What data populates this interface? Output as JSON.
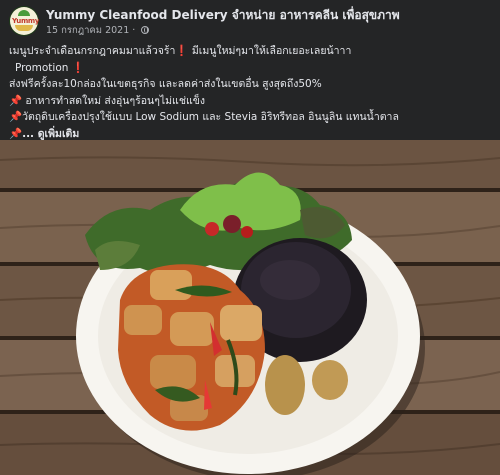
{
  "post": {
    "page_name": "Yummy Cleanfood Delivery จำหน่าย อาหารคลีน เพื่อสุขภาพ",
    "date": "15 กรกฎาคม 2021",
    "logo_text": "Yummy",
    "lines": {
      "l1": "เมนูประจำเดือนกรกฎาคมมาแล้วจร้า",
      "l1b": "มีเมนูใหม่ๆมาให้เลือกเยอะเลยน้าาา",
      "l2": "Promotion",
      "l3": "ส่งฟรีครั้งละ10กล่องในเขตธุรกิจ และลดค่าส่งในเขตอื่น สูงสุดถึง50%",
      "l4": "อาหารทำสดใหม่ ส่งอุ่นๆร้อนๆไม่แช่แข็ง",
      "l5": "วัตถุดิบเครื่องปรุงใช้แบบ Low Sodium และ Stevia อิริทรีทอล อินนูลิน แทนน้ำตาล",
      "more": "... ดูเพิ่มเติม"
    },
    "glyphs": {
      "exclaim": "❗",
      "pin": "📌"
    }
  },
  "colors": {
    "background": "#242526",
    "text": "#e4e6eb",
    "secondary": "#b0b3b8",
    "accent_red": "#e53935"
  }
}
